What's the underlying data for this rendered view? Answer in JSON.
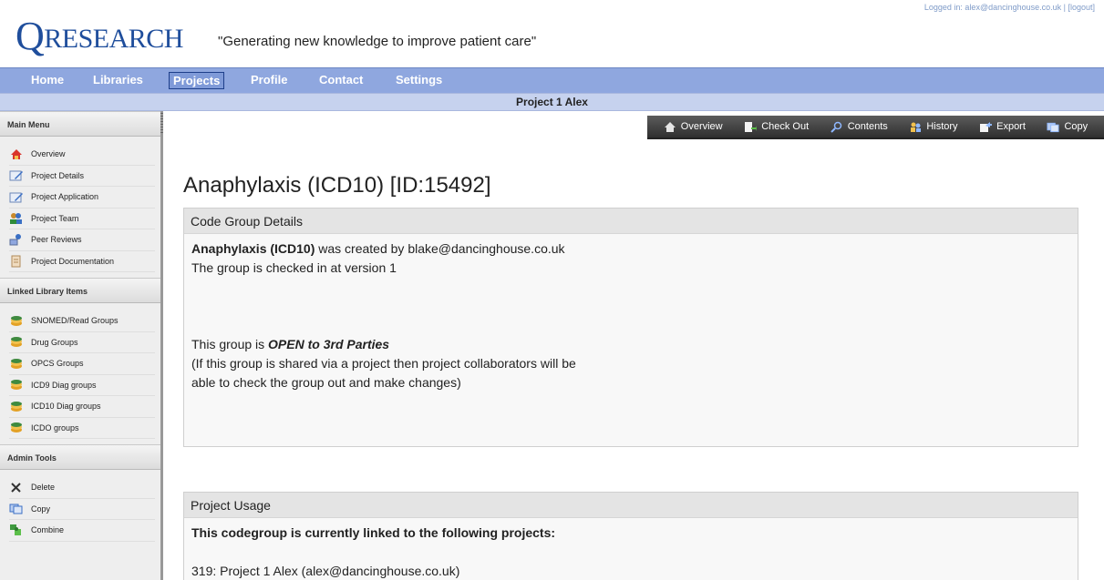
{
  "header": {
    "logo_q": "Q",
    "logo_rest": "RESEARCH",
    "tagline": "\"Generating new knowledge to improve patient care\"",
    "login_info": "Logged in: alex@dancinghouse.co.uk | [logout]"
  },
  "nav": {
    "items": [
      {
        "label": "Home"
      },
      {
        "label": "Libraries"
      },
      {
        "label": "Projects",
        "active": true
      },
      {
        "label": "Profile"
      },
      {
        "label": "Contact"
      },
      {
        "label": "Settings"
      }
    ]
  },
  "project_bar": {
    "title": "Project 1 Alex"
  },
  "sidebar": {
    "main_menu_title": "Main Menu",
    "main_menu": [
      {
        "label": "Overview",
        "icon": "home-icon"
      },
      {
        "label": "Project Details",
        "icon": "edit-document-icon"
      },
      {
        "label": "Project Application",
        "icon": "edit-document-icon"
      },
      {
        "label": "Project Team",
        "icon": "team-icon"
      },
      {
        "label": "Peer Reviews",
        "icon": "review-icon"
      },
      {
        "label": "Project Documentation",
        "icon": "document-icon"
      }
    ],
    "linked_title": "Linked Library Items",
    "linked": [
      {
        "label": "SNOMED/Read Groups",
        "icon": "stack-icon"
      },
      {
        "label": "Drug Groups",
        "icon": "stack-icon"
      },
      {
        "label": "OPCS Groups",
        "icon": "stack-icon"
      },
      {
        "label": "ICD9 Diag groups",
        "icon": "stack-icon"
      },
      {
        "label": "ICD10 Diag groups",
        "icon": "stack-icon"
      },
      {
        "label": "ICDO groups",
        "icon": "stack-icon"
      }
    ],
    "admin_title": "Admin Tools",
    "admin": [
      {
        "label": "Delete",
        "icon": "delete-icon"
      },
      {
        "label": "Copy",
        "icon": "copy-icon"
      },
      {
        "label": "Combine",
        "icon": "combine-icon"
      }
    ]
  },
  "toolbar": {
    "items": [
      {
        "label": "Overview",
        "icon": "home-icon"
      },
      {
        "label": "Check Out",
        "icon": "checkout-icon"
      },
      {
        "label": "Contents",
        "icon": "magnifier-icon"
      },
      {
        "label": "History",
        "icon": "history-icon"
      },
      {
        "label": "Export",
        "icon": "export-icon"
      },
      {
        "label": "Copy",
        "icon": "copy-icon"
      }
    ]
  },
  "main": {
    "title": "Anaphylaxis (ICD10) [ID:15492]",
    "details": {
      "heading": "Code Group Details",
      "group_name": "Anaphylaxis (ICD10)",
      "created_by_text": " was created by blake@dancinghouse.co.uk",
      "version_text": "The group is checked in at version 1",
      "open_prefix": "This group is ",
      "open_status": "OPEN to 3rd Parties",
      "share_note_1": "(If this group is shared via a project then project collaborators will be",
      "share_note_2": "able to check the group out and make changes)"
    },
    "usage": {
      "heading": "Project Usage",
      "linked_text": "This codegroup is currently linked to the following projects:",
      "project_line": "319: Project 1 Alex (alex@dancinghouse.co.uk)"
    }
  },
  "colors": {
    "nav_bg": "#8fa7df",
    "project_bar_bg": "#c6d2ee",
    "logo": "#1f4e9c",
    "toolbar_bg": "#3f3f3f"
  }
}
